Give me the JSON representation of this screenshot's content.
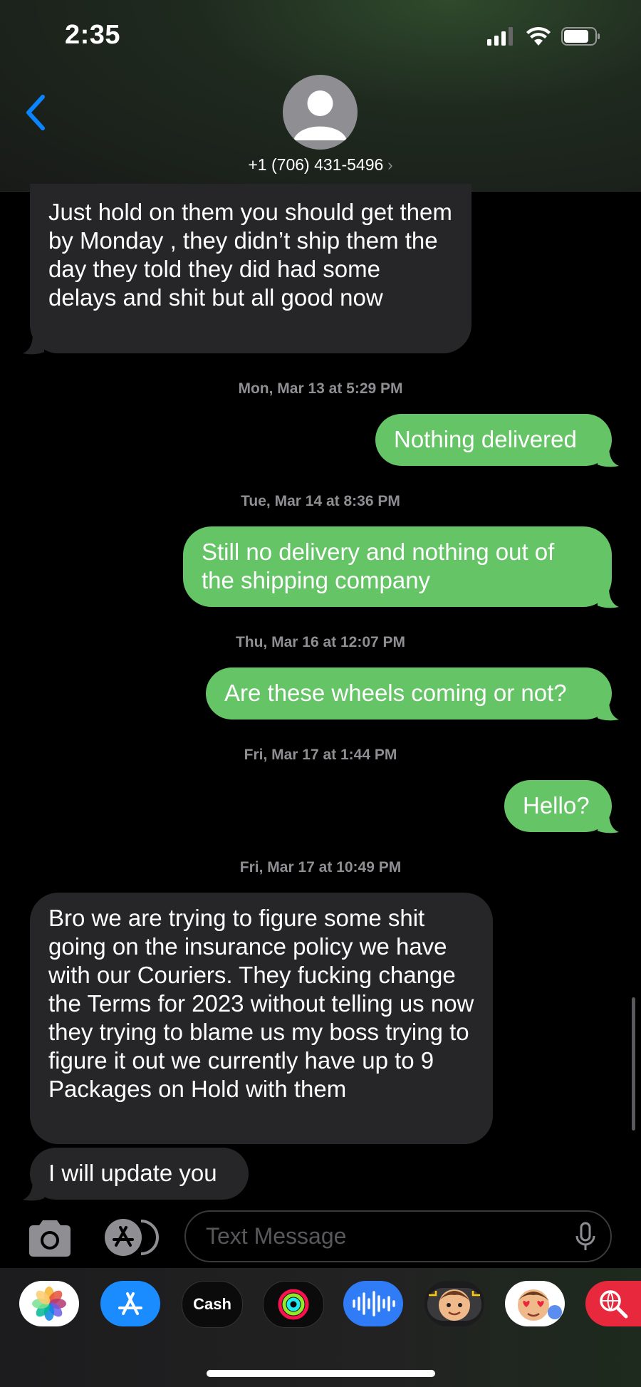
{
  "status_bar": {
    "time": "2:35"
  },
  "header": {
    "contact": "+1 (706) 431-5496",
    "chevron": "›"
  },
  "messages": [
    {
      "type": "in",
      "text": "Just hold on them you should get them by Monday , they didn’t ship them the day they told they did had some delays and shit but all good now"
    },
    {
      "type": "stamp",
      "text": "Mon, Mar 13 at 5:29 PM"
    },
    {
      "type": "out",
      "text": "Nothing delivered"
    },
    {
      "type": "stamp",
      "text": "Tue, Mar 14 at 8:36 PM"
    },
    {
      "type": "out",
      "text": "Still no delivery and nothing out of the shipping company"
    },
    {
      "type": "stamp",
      "text": "Thu, Mar 16 at 12:07 PM"
    },
    {
      "type": "out",
      "text": "Are these wheels coming or not?"
    },
    {
      "type": "stamp",
      "text": "Fri, Mar 17 at 1:44 PM"
    },
    {
      "type": "out",
      "text": "Hello?"
    },
    {
      "type": "stamp",
      "text": "Fri, Mar 17 at 10:49 PM"
    },
    {
      "type": "in",
      "text": "Bro we are trying to figure some shit going on the insurance policy we have with our Couriers. They fucking change the Terms for 2023 without telling us now they trying to blame us my boss trying to figure it out we currently have up to 9 Packages on Hold with them"
    },
    {
      "type": "in",
      "text": "I will update you"
    }
  ],
  "input": {
    "placeholder": "Text Message"
  },
  "drawer": {
    "apps": [
      {
        "name": "photos-icon"
      },
      {
        "name": "app-store-icon"
      },
      {
        "name": "apple-cash-icon",
        "label": "Cash"
      },
      {
        "name": "activity-icon"
      },
      {
        "name": "audio-message-icon"
      },
      {
        "name": "memoji-icon"
      },
      {
        "name": "memoji-stickers-icon"
      },
      {
        "name": "image-search-icon"
      }
    ]
  },
  "colors": {
    "outgoing": "#65c466",
    "incoming": "#262628",
    "accent": "#0a84ff"
  }
}
